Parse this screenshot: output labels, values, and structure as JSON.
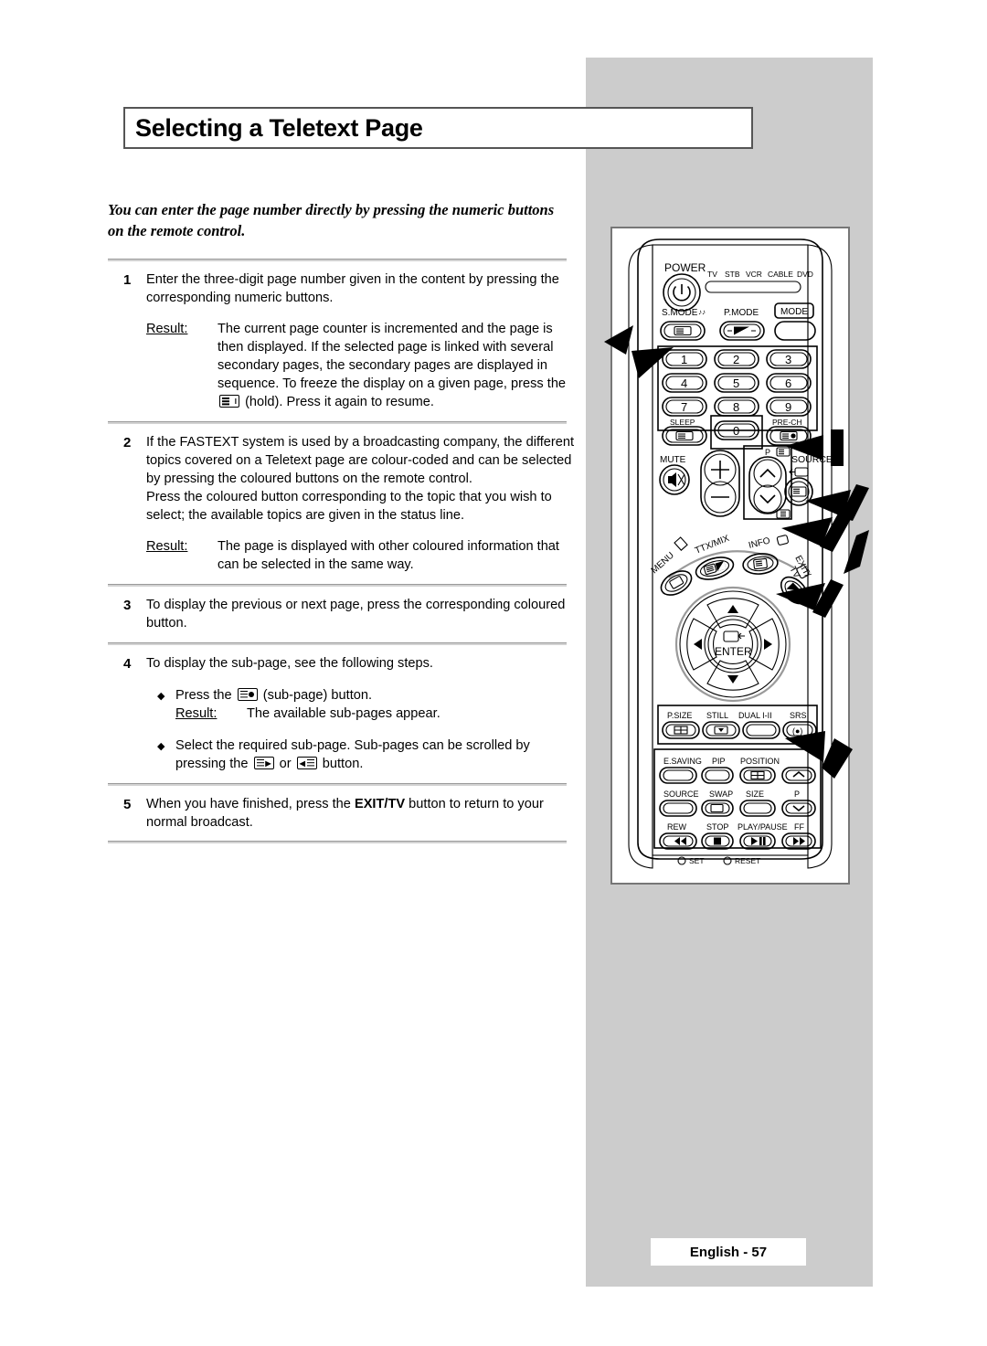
{
  "page": {
    "title": "Selecting a Teletext Page",
    "footer": "English - 57",
    "intro": "You can enter the page number directly by pressing the numeric buttons on the remote control."
  },
  "steps": [
    {
      "number": "1",
      "text": "Enter the three-digit page number given in the content by pressing the corresponding numeric buttons.",
      "result_label": "Result:",
      "result_text_a": "The current page counter is incremented and the page is then displayed. If the selected page is linked with several secondary pages, the secondary pages are displayed in sequence. To freeze the display on a given page, press the",
      "result_text_b": "(hold). Press it again to resume."
    },
    {
      "number": "2",
      "text": "If the FASTEXT system is used by a broadcasting company, the different topics covered on a Teletext page are colour-coded and can be selected by pressing the coloured buttons on the remote control.",
      "text2": "Press the coloured button corresponding to the topic that you wish to select; the available topics are given in the status line.",
      "result_label": "Result:",
      "result_text": "The page is displayed with other coloured information that can be selected in the same way."
    },
    {
      "number": "3",
      "text": "To display the previous or next page, press the corresponding coloured button."
    },
    {
      "number": "4",
      "text": "To display the sub-page, see the following steps.",
      "bullet1_a": "Press the",
      "bullet1_b": "(sub-page) button.",
      "bullet1_result_label": "Result:",
      "bullet1_result_text": "The available sub-pages appear.",
      "bullet2_a": "Select the required sub-page. Sub-pages can be scrolled by pressing the",
      "bullet2_or": "or",
      "bullet2_b": "button."
    },
    {
      "number": "5",
      "text_a": "When you have finished, press the",
      "text_bold": "EXIT/TV",
      "text_b": "button to return to your normal broadcast."
    }
  ],
  "remote": {
    "power_label": "POWER",
    "device_modes": [
      "TV",
      "STB",
      "VCR",
      "CABLE",
      "DVD"
    ],
    "smode_label": "S.MODE",
    "pmode_label": "P.MODE",
    "mode_button": "MODE",
    "numeric_keys": [
      "1",
      "2",
      "3",
      "4",
      "5",
      "6",
      "7",
      "8",
      "9",
      "0"
    ],
    "sleep_label": "SLEEP",
    "prech_label": "PRE-CH",
    "mute_label": "MUTE",
    "p_label": "P",
    "source_label": "SOURCE",
    "menu_label": "MENU",
    "ttxmix_label": "TTX/MIX",
    "info_label": "INFO",
    "exittv_label_1": "EXIT/",
    "exittv_label_2": "TV",
    "enter_label": "ENTER",
    "row_psize": [
      "P.SIZE",
      "STILL",
      "DUAL I-II",
      "SRS"
    ],
    "row_esaving": [
      "E.SAVING",
      "PIP",
      "POSITION"
    ],
    "row_source": [
      "SOURCE",
      "SWAP",
      "SIZE",
      "P"
    ],
    "row_transport": [
      "REW",
      "STOP",
      "PLAY/PAUSE",
      "FF"
    ],
    "set_label": "SET",
    "reset_label": "RESET"
  },
  "colors": {
    "panel_grey": "#cccccc",
    "rule_grey": "#9a9a9a",
    "border_grey": "#777777",
    "text": "#000000"
  }
}
